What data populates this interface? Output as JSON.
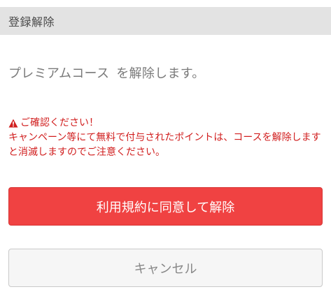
{
  "header": {
    "title": "登録解除"
  },
  "message": {
    "course_name": "プレミアムコース",
    "text": "を解除します。"
  },
  "warning": {
    "icon": "warning-icon",
    "heading": "ご確認ください！",
    "body": "キャンペーン等にて無料で付与されたポイントは、コースを解除しますと消滅しますのでご注意ください。",
    "color": "#d11f1f"
  },
  "buttons": {
    "agree_label": "利用規約に同意して解除",
    "cancel_label": "キャンセル"
  },
  "colors": {
    "accent": "#f04242",
    "header_bg": "#e3e3e3"
  }
}
